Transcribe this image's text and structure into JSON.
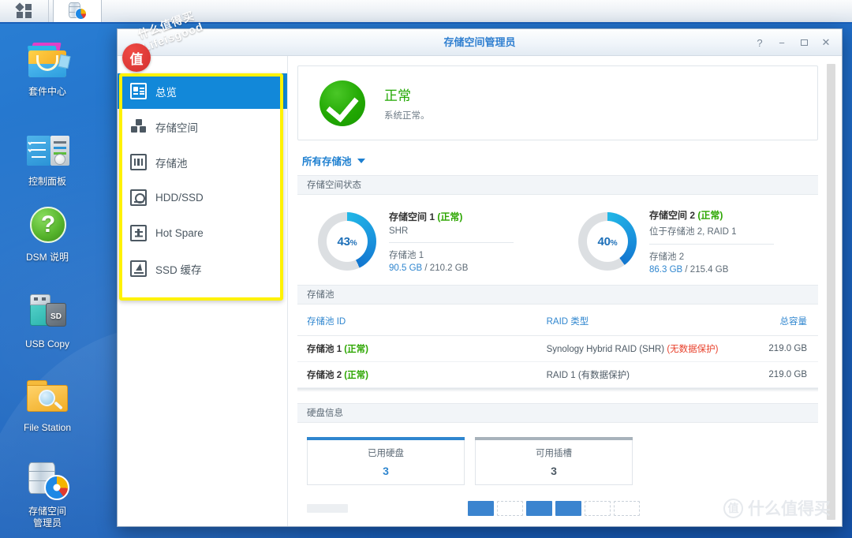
{
  "taskbar": {
    "menu_icon": "app-grid-icon",
    "app_icon": "storage-manager-icon"
  },
  "desktop": {
    "icons": [
      {
        "label": "套件中心",
        "icon": "package-center-icon"
      },
      {
        "label": "控制面板",
        "icon": "control-panel-icon"
      },
      {
        "label": "DSM 说明",
        "icon": "dsm-help-icon"
      },
      {
        "label": "USB Copy",
        "icon": "usb-copy-icon"
      },
      {
        "label": "File Station",
        "icon": "file-station-icon"
      },
      {
        "label": "存储空间\n管理员",
        "icon": "storage-manager-icon"
      }
    ],
    "icon_labels": {
      "package_center": "套件中心",
      "control_panel": "控制面板",
      "dsm_help": "DSM 说明",
      "usb_copy": "USB Copy",
      "file_station": "File Station",
      "storage_manager_line1": "存储空间",
      "storage_manager_line2": "管理员"
    }
  },
  "window": {
    "title": "存储空间管理员",
    "controls": {
      "help": "?",
      "minimize": "−",
      "maximize": "□",
      "close": "✕"
    }
  },
  "nav": {
    "items": [
      {
        "label": "总览",
        "icon": "overview-icon",
        "active": true
      },
      {
        "label": "存储空间",
        "icon": "volume-icon",
        "active": false
      },
      {
        "label": "存储池",
        "icon": "storage-pool-icon",
        "active": false
      },
      {
        "label": "HDD/SSD",
        "icon": "hdd-icon",
        "active": false
      },
      {
        "label": "Hot Spare",
        "icon": "hot-spare-icon",
        "active": false
      },
      {
        "label": "SSD 缓存",
        "icon": "ssd-cache-icon",
        "active": false
      }
    ],
    "highlight_color": "#fff200"
  },
  "status": {
    "icon": "check-circle-icon",
    "title": "正常",
    "desc": "系统正常。",
    "color": "#22a803"
  },
  "pool_selector": {
    "label": "所有存储池",
    "caret": "chevron-down-icon"
  },
  "volume_section": {
    "header": "存储空间状态",
    "volumes": [
      {
        "percent": "43",
        "percent_symbol": "%",
        "percent_value": 43,
        "name": "存储空间 1",
        "status": "(正常)",
        "raid": "SHR",
        "pool": "存储池 1",
        "used": "90.5 GB",
        "total": "/ 210.2 GB"
      },
      {
        "percent": "40",
        "percent_symbol": "%",
        "percent_value": 40,
        "name": "存储空间 2",
        "status": "(正常)",
        "raid": "位于存储池 2, RAID 1",
        "pool": "存储池 2",
        "used": "86.3 GB",
        "total": "/ 215.4 GB"
      }
    ]
  },
  "pool_section": {
    "header": "存储池",
    "columns": [
      "存储池 ID",
      "RAID 类型",
      "总容量"
    ],
    "rows": [
      {
        "id": "存储池 1",
        "id_status": "(正常)",
        "raid": "Synology Hybrid RAID (SHR)",
        "raid_note": "(无数据保护)",
        "capacity": "219.0 GB"
      },
      {
        "id": "存储池 2",
        "id_status": "(正常)",
        "raid": "RAID 1 (有数据保护)",
        "raid_note": "",
        "capacity": "219.0 GB"
      }
    ]
  },
  "disk_section": {
    "header": "硬盘信息",
    "cards": [
      {
        "label": "已用硬盘",
        "value": "3",
        "accent": "#2f86cf",
        "value_color": "#2f86cf"
      },
      {
        "label": "可用插槽",
        "value": "3",
        "accent": "#a8b2bb",
        "value_color": "#4d5a65"
      }
    ],
    "slots": [
      "used",
      "free",
      "used",
      "used",
      "free",
      "free"
    ]
  },
  "watermark": {
    "top_line1": "什么值得买",
    "top_line2": "Lifeisgood",
    "badge": "值",
    "bottom_ring": "值",
    "bottom_text": "什么值得买"
  }
}
